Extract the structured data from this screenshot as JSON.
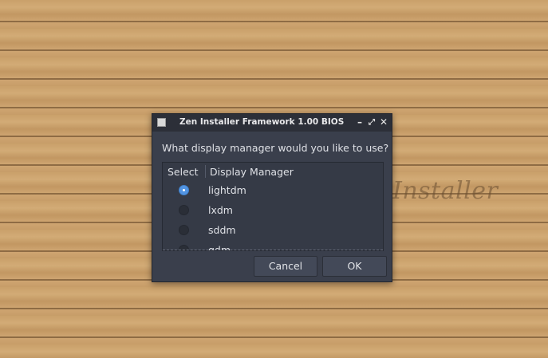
{
  "desktop": {
    "wallpaper_text": "Installer"
  },
  "dialog": {
    "title": "Zen Installer Framework 1.00 BIOS",
    "titlebar_buttons": {
      "minimize": "–",
      "maximize": "⤢",
      "close": "✕"
    },
    "question": "What display manager would you like to use?",
    "list": {
      "columns": [
        "Select",
        "Display Manager"
      ],
      "rows": [
        {
          "label": "lightdm",
          "selected": true
        },
        {
          "label": "lxdm",
          "selected": false
        },
        {
          "label": "sddm",
          "selected": false
        },
        {
          "label": "gdm",
          "selected": false
        }
      ]
    },
    "buttons": {
      "cancel": "Cancel",
      "ok": "OK"
    }
  },
  "colors": {
    "accent": "#5294e2",
    "dialog_bg": "#3a3f4c",
    "titlebar_bg": "#2c2f38",
    "wallpaper": "#c39a63"
  }
}
